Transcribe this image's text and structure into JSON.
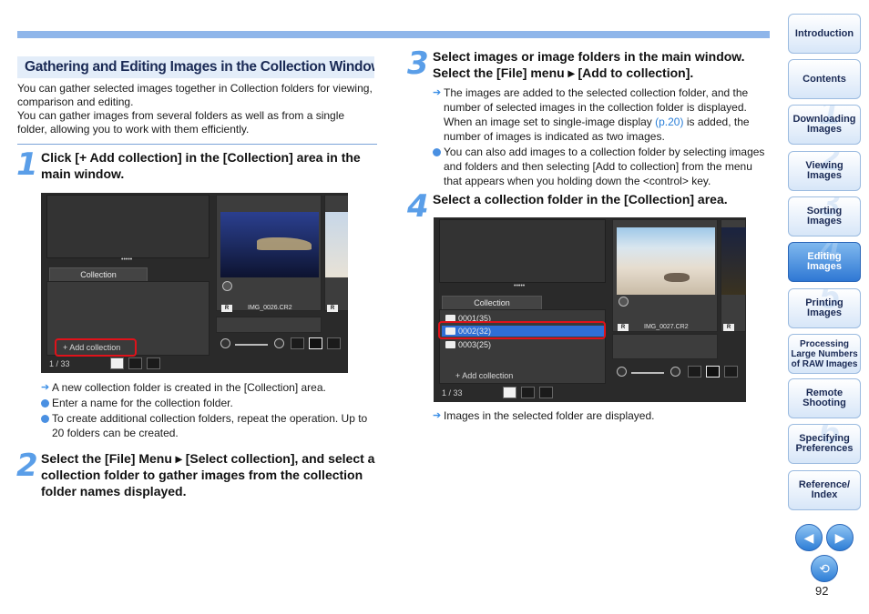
{
  "section_title": "Gathering and Editing Images in the Collection Window",
  "intro": [
    "You can gather selected images together in Collection folders for viewing, comparison and editing.",
    "You can gather images from several folders as well as from a single folder, allowing you to work with them efficiently."
  ],
  "steps": [
    {
      "num": "1",
      "text": "Click [+ Add collection] in the [Collection] area in the main window."
    },
    {
      "num": "2",
      "text": "Select the [File] Menu ▸ [Select collection], and select a collection folder to gather images from the collection folder names displayed."
    },
    {
      "num": "3",
      "text": "Select images or image folders in the main window. Select the [File] menu ▸ [Add to collection]."
    },
    {
      "num": "4",
      "text": "Select a collection folder in the [Collection] area."
    }
  ],
  "step1_notes": {
    "result": "A new collection folder is created in the [Collection] area.",
    "bullets": [
      "Enter a name for the collection folder.",
      "To create additional collection folders, repeat the operation. Up to 20 folders can be created."
    ]
  },
  "step3_notes": {
    "result_before": "The images are added to the selected collection folder, and the number of selected images in the collection folder is displayed. When an image set to single-image display ",
    "result_link": "(p.20)",
    "result_after": " is added, the number of images is indicated as two images.",
    "bullet": "You can also add images to a collection folder by selecting images and folders and then selecting [Add to collection] from the menu that appears when you holding down the <control> key."
  },
  "step4_note": "Images in the selected folder are displayed.",
  "screenshot1": {
    "tab": "Collection",
    "add_button": "+ Add collection",
    "status": "1 / 33",
    "filename": "IMG_0026.CR2",
    "badge": "R",
    "handle": "•••••"
  },
  "screenshot2": {
    "tab": "Collection",
    "folders": [
      "0001(35)",
      "0002(32)",
      "0003(25)"
    ],
    "add_button": "+ Add collection",
    "status": "1 / 33",
    "filename": "IMG_0027.CR2",
    "badge": "R",
    "handle": "•••••"
  },
  "nav": [
    {
      "label": "Introduction",
      "num": ""
    },
    {
      "label": "Contents",
      "num": ""
    },
    {
      "label": "Downloading Images",
      "num": "1"
    },
    {
      "label": "Viewing Images",
      "num": "2"
    },
    {
      "label": "Sorting Images",
      "num": "3"
    },
    {
      "label": "Editing Images",
      "num": "4"
    },
    {
      "label": "Printing Images",
      "num": "5"
    },
    {
      "label": "Processing Large Numbers of RAW Images",
      "num": ""
    },
    {
      "label": "Remote Shooting",
      "num": ""
    },
    {
      "label": "Specifying Preferences",
      "num": "6"
    },
    {
      "label": "Reference/ Index",
      "num": ""
    }
  ],
  "page_number": "92",
  "colors": {
    "accent": "#5a9ee8",
    "nav_active": "#2f78d4",
    "highlight": "#e0121a"
  }
}
